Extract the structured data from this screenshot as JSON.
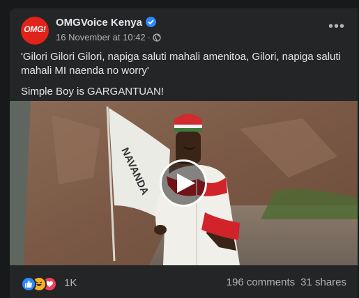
{
  "post": {
    "page_name": "OMGVoice Kenya",
    "avatar_text": "OMG!",
    "timestamp": "16 November at 10:42",
    "separator": "·",
    "audience_icon": "globe-icon",
    "verified_icon": "verified-badge-icon",
    "more_label": "•••",
    "text_line_1": "'Gilori Gilori Gilori, napiga saluti mahali amenitoa, Gilori, napiga saluti mahali MI naenda no worry'",
    "text_line_2": "Simple Boy is GARGANTUAN!",
    "flag_text": "NAVANDA"
  },
  "footer": {
    "reaction_icons": [
      "like-icon",
      "haha-icon",
      "love-icon"
    ],
    "reaction_count": "1K",
    "comments": "196 comments",
    "shares": "31 shares"
  },
  "colors": {
    "background": "#18191a",
    "card": "#242526",
    "primary_text": "#e4e6eb",
    "secondary_text": "#b0b3b8",
    "brand_red": "#e2231a",
    "facebook_blue": "#2d88ff"
  }
}
